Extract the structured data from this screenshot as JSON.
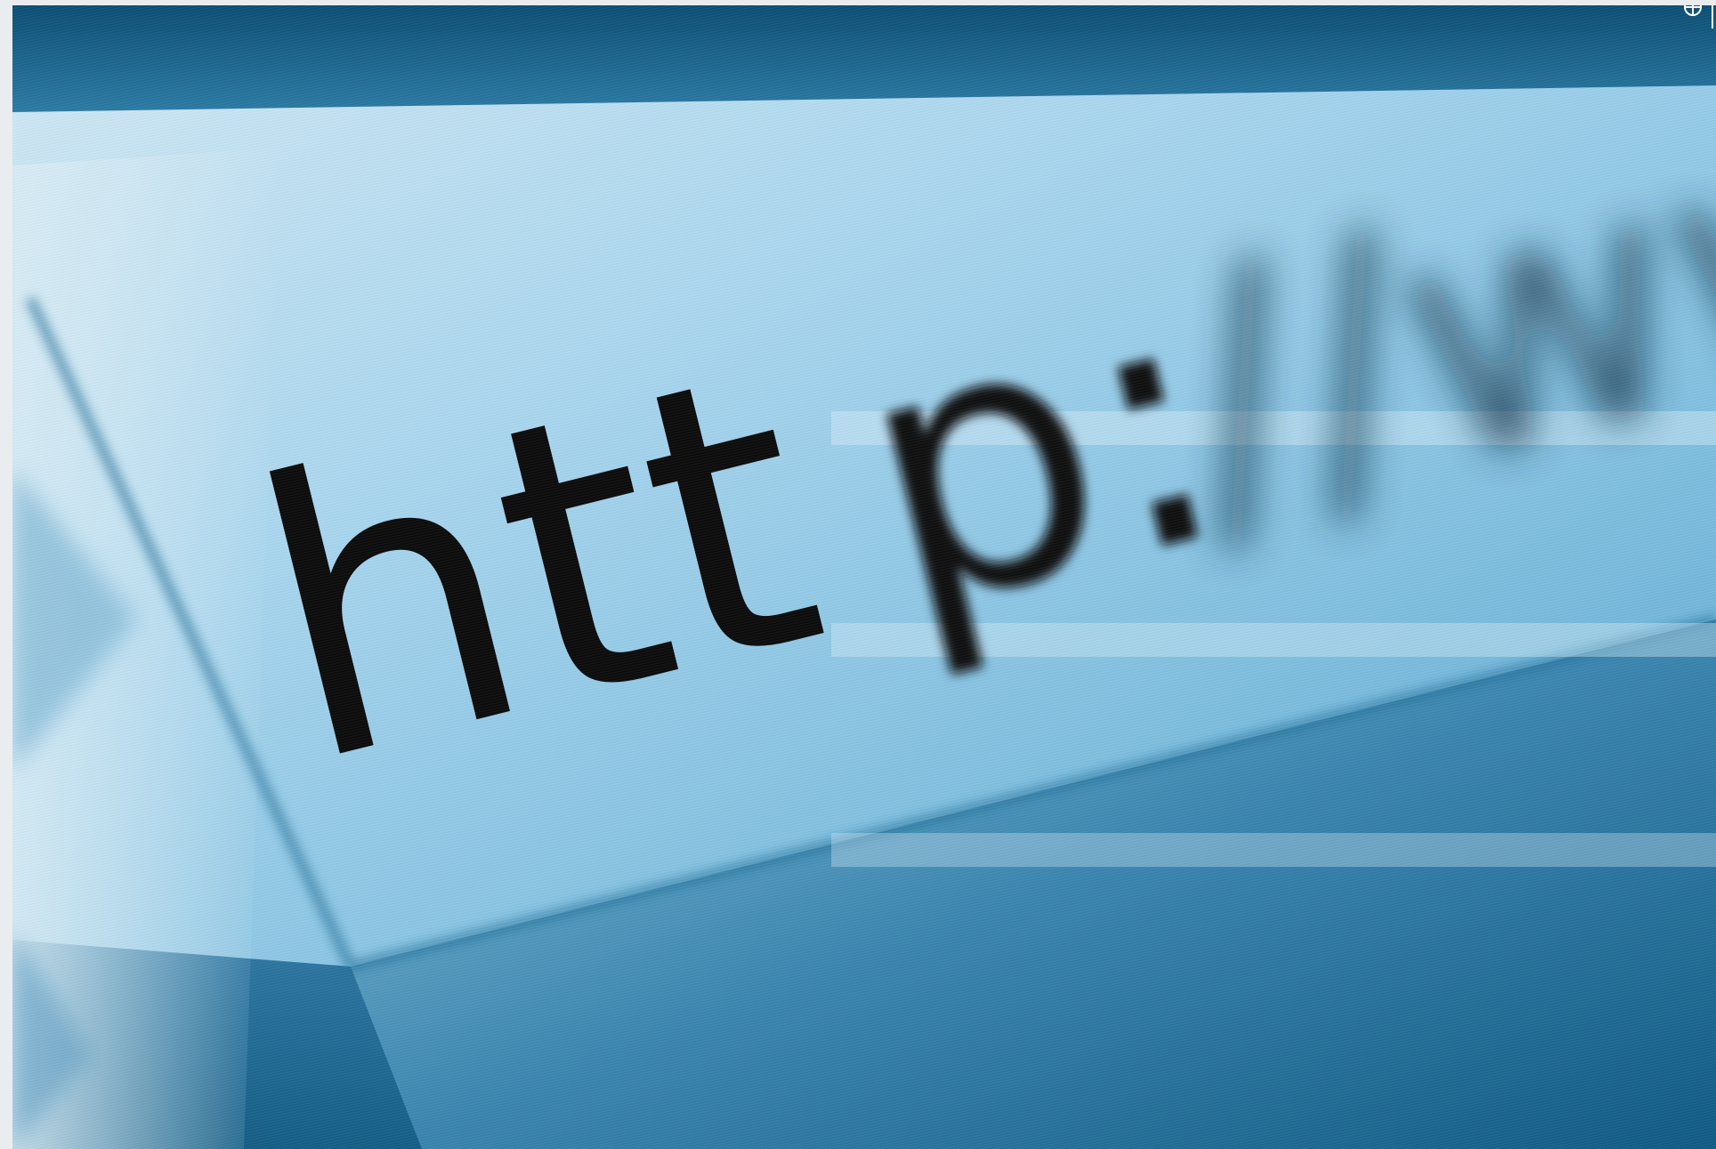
{
  "photo": {
    "address_text": "http://www",
    "colors": {
      "deep_blue": "#0b4e74",
      "mid_blue": "#3f8fb9",
      "light_blue": "#9fd4ee",
      "text_black": "#0a0a0a"
    }
  }
}
